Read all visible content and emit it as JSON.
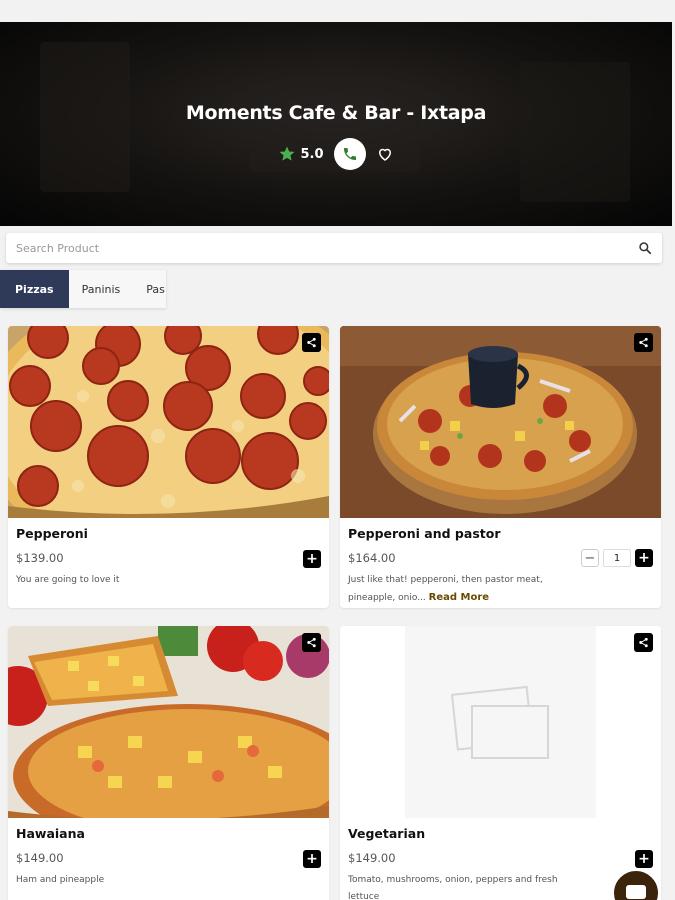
{
  "header": {
    "title": "Moments Cafe & Bar - Ixtapa",
    "rating": "5.0",
    "star_color": "#4caf50"
  },
  "search": {
    "placeholder": "Search Product",
    "value": ""
  },
  "categories": {
    "items": [
      {
        "label": "Pizzas",
        "active": true
      },
      {
        "label": "Paninis",
        "active": false
      },
      {
        "label": "Pas",
        "active": false
      }
    ]
  },
  "products": [
    {
      "name": "Pepperoni",
      "price": "$139.00",
      "description": "You are going to love it"
    },
    {
      "name": "Pepperoni and pastor",
      "price": "$164.00",
      "description": "Just like that! pepperoni, then pastor meat, pineapple, onio...",
      "read_more": "Read More",
      "quantity": "1"
    },
    {
      "name": "Hawaiana",
      "price": "$149.00",
      "description": "Ham and pineapple"
    },
    {
      "name": "Vegetarian",
      "price": "$149.00",
      "description": "Tomato, mushrooms, onion, peppers and fresh lettuce"
    }
  ],
  "colors": {
    "accent": "#2e3a57",
    "link": "#6b4a00",
    "fab": "#3b230c"
  },
  "icons": [
    "star-icon",
    "phone-icon",
    "heart-icon",
    "search-icon",
    "share-icon",
    "plus-icon",
    "minus-icon",
    "chat-icon",
    "image-placeholder-icon"
  ]
}
